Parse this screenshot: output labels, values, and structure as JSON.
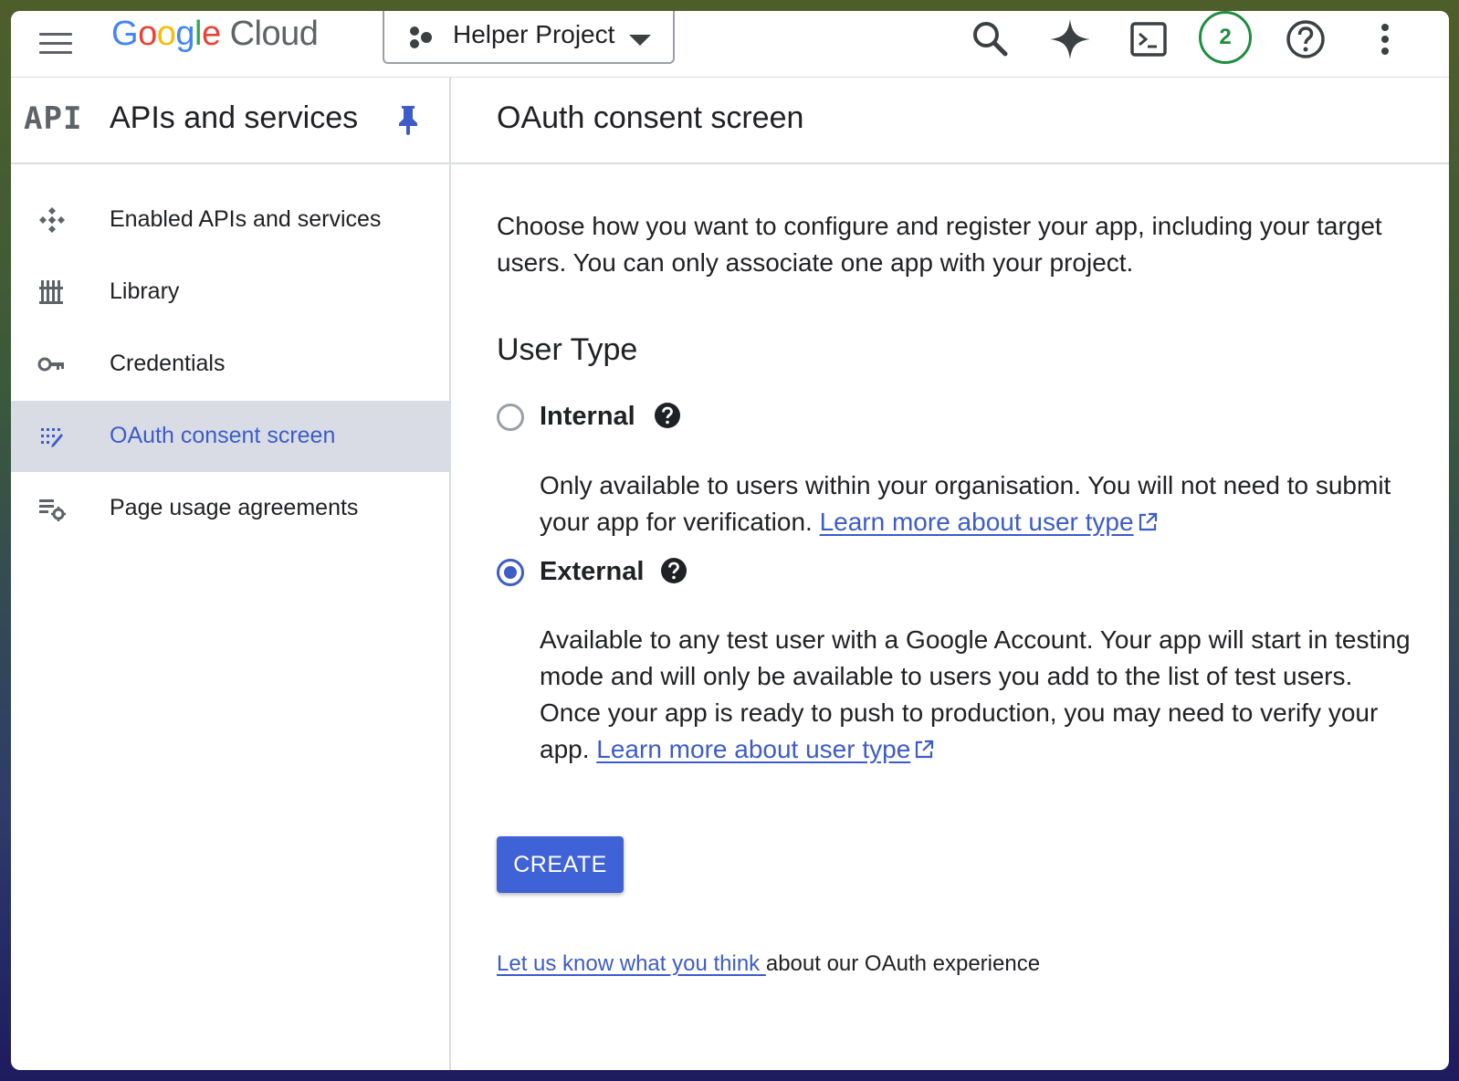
{
  "topbar": {
    "logo_google": [
      "G",
      "o",
      "o",
      "g",
      "l",
      "e"
    ],
    "logo_cloud": "Cloud",
    "project_name": "Helper Project",
    "notification_count": "2"
  },
  "sidebar": {
    "logo_text": "API",
    "title": "APIs and services",
    "items": [
      {
        "label": "Enabled APIs and services",
        "icon": "enabled-apis-icon",
        "active": false
      },
      {
        "label": "Library",
        "icon": "library-icon",
        "active": false
      },
      {
        "label": "Credentials",
        "icon": "key-icon",
        "active": false
      },
      {
        "label": "OAuth consent screen",
        "icon": "consent-icon",
        "active": true
      },
      {
        "label": "Page usage agreements",
        "icon": "agreements-icon",
        "active": false
      }
    ]
  },
  "main": {
    "title": "OAuth consent screen",
    "intro": "Choose how you want to configure and register your app, including your target users. You can only associate one app with your project.",
    "section_title": "User Type",
    "options": [
      {
        "label": "Internal",
        "selected": false,
        "description": "Only available to users within your organisation. You will not need to submit your app for verification.",
        "link": "Learn more about user type"
      },
      {
        "label": "External",
        "selected": true,
        "description": "Available to any test user with a Google Account. Your app will start in testing mode and will only be available to users you add to the list of test users. Once your app is ready to push to production, you may need to verify your app.",
        "link": "Learn more about user type"
      }
    ],
    "create_label": "CREATE",
    "feedback_link": "Let us know what you think ",
    "feedback_text": "about our OAuth experience"
  },
  "colors": {
    "accent": "#3d5cc7",
    "active_nav_bg": "#d9dce5",
    "badge_green": "#1e8e3e"
  }
}
